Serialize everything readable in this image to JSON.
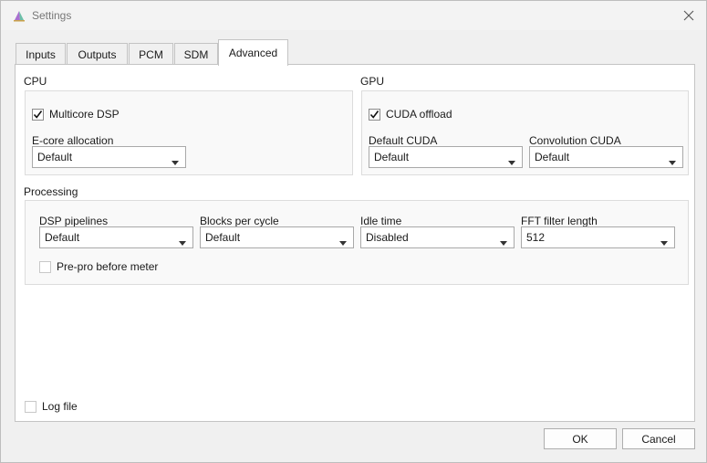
{
  "window": {
    "title": "Settings"
  },
  "tabs": [
    {
      "label": "Inputs",
      "active": false
    },
    {
      "label": "Outputs",
      "active": false
    },
    {
      "label": "PCM",
      "active": false
    },
    {
      "label": "SDM",
      "active": false
    },
    {
      "label": "Advanced",
      "active": true
    }
  ],
  "cpu": {
    "title": "CPU",
    "multicore": {
      "label": "Multicore DSP",
      "checked": true
    },
    "ecore": {
      "label": "E-core allocation",
      "value": "Default"
    }
  },
  "gpu": {
    "title": "GPU",
    "cuda_offload": {
      "label": "CUDA offload",
      "checked": true
    },
    "default_cuda": {
      "label": "Default CUDA",
      "value": "Default"
    },
    "convolution_cuda": {
      "label": "Convolution CUDA",
      "value": "Default"
    }
  },
  "processing": {
    "title": "Processing",
    "dsp_pipelines": {
      "label": "DSP pipelines",
      "value": "Default"
    },
    "blocks_per_cycle": {
      "label": "Blocks per cycle",
      "value": "Default"
    },
    "idle_time": {
      "label": "Idle time",
      "value": "Disabled"
    },
    "fft_filter_length": {
      "label": "FFT filter length",
      "value": "512"
    },
    "prepro": {
      "label": "Pre-pro before meter",
      "checked": false
    }
  },
  "logfile": {
    "label": "Log file",
    "checked": false
  },
  "buttons": {
    "ok": "OK",
    "cancel": "Cancel"
  }
}
